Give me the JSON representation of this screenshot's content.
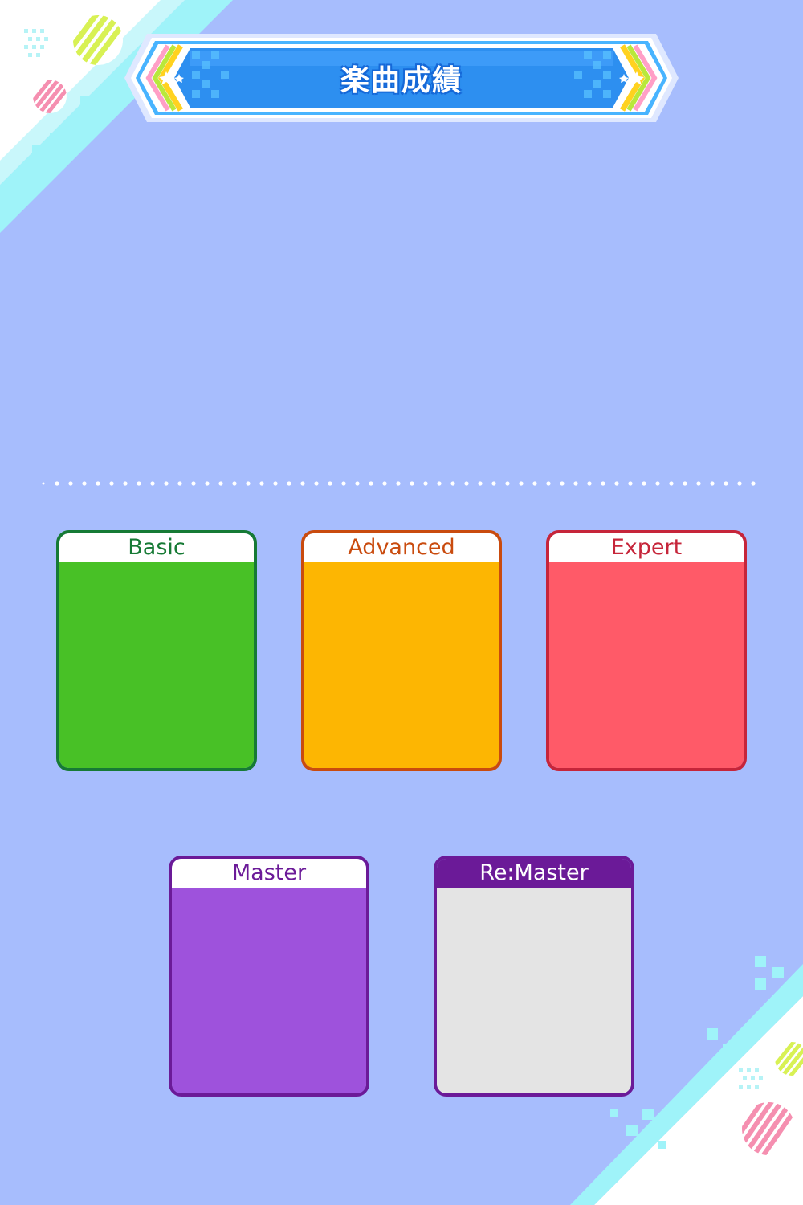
{
  "header": {
    "title": "楽曲成績"
  },
  "difficulties": [
    {
      "label": "Basic",
      "accent": "#167a35",
      "fill": "#48c126"
    },
    {
      "label": "Advanced",
      "accent": "#c94b0e",
      "fill": "#fdb602"
    },
    {
      "label": "Expert",
      "accent": "#c6253a",
      "fill": "#ff5a68"
    },
    {
      "label": "Master",
      "accent": "#6b1a98",
      "fill": "#9e52dc"
    },
    {
      "label": "Re:Master",
      "accent": "#6b1a98",
      "fill": "#e4e4e4"
    }
  ],
  "theme": {
    "background": "#a7bdfd",
    "banner": "#2d8ff0"
  }
}
